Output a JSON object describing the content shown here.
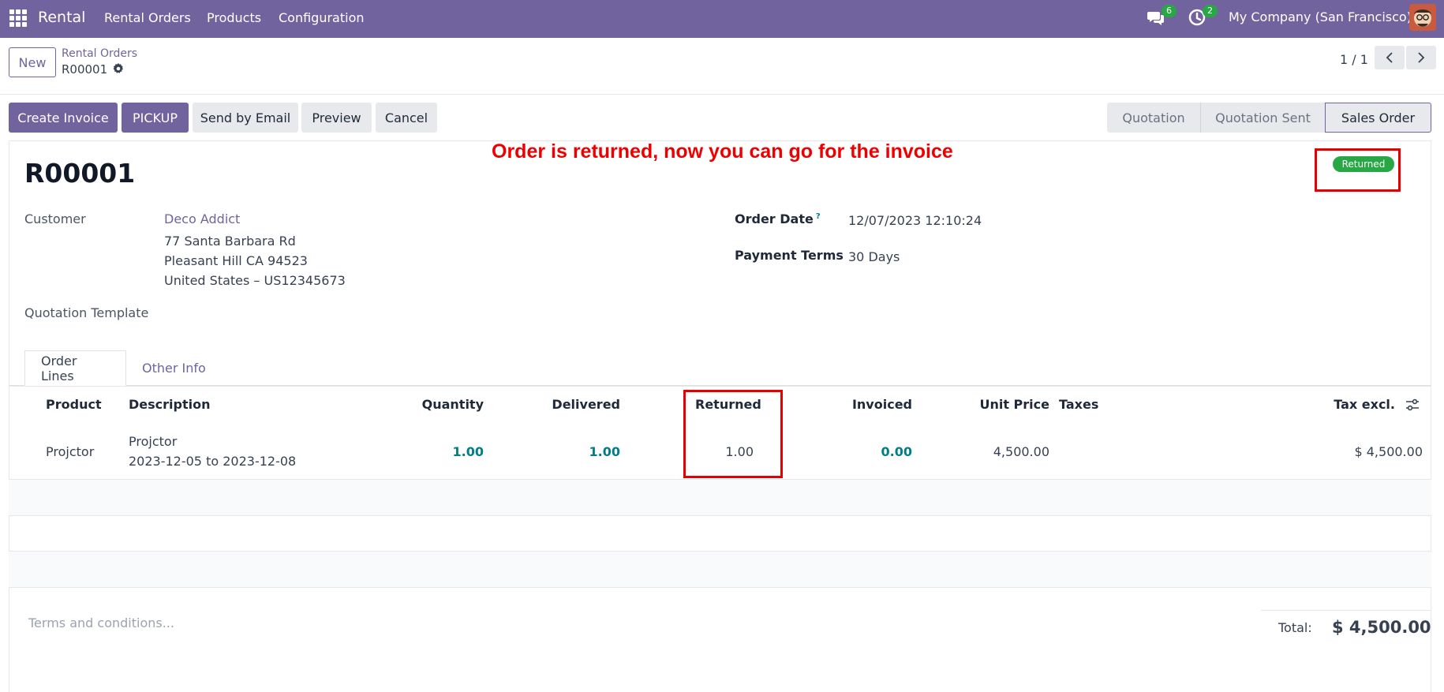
{
  "navbar": {
    "app_name": "Rental",
    "menus": [
      "Rental Orders",
      "Products",
      "Configuration"
    ],
    "messages_count": "6",
    "activities_count": "2",
    "company": "My Company (San Francisco)",
    "bg_color": "#71639e"
  },
  "breadcrumb": {
    "new_label": "New",
    "parent": "Rental Orders",
    "current": "R00001"
  },
  "pager": {
    "value": "1 / 1",
    "prev_icon": "chevron-left-icon",
    "next_icon": "chevron-right-icon"
  },
  "actions": {
    "create_invoice": "Create Invoice",
    "pickup": "PICKUP",
    "send_email": "Send by Email",
    "preview": "Preview",
    "cancel": "Cancel"
  },
  "statusbar": {
    "stages": [
      "Quotation",
      "Quotation Sent",
      "Sales Order"
    ],
    "active": "Sales Order"
  },
  "annotation": "Order is returned, now you can go for the invoice",
  "ribbon": {
    "label": "Returned",
    "color": "#28a745"
  },
  "form": {
    "name": "R00001",
    "customer_label": "Customer",
    "customer_name": "Deco Addict",
    "address_line1": "77 Santa Barbara Rd",
    "address_line2": "Pleasant Hill CA 94523",
    "address_line3": "United States – US12345673",
    "quotation_template_label": "Quotation Template",
    "order_date_label": "Order Date",
    "order_date_help": "?",
    "order_date_value": "12/07/2023 12:10:24",
    "payment_terms_label": "Payment Terms",
    "payment_terms_value": "30 Days"
  },
  "tabs": [
    "Order Lines",
    "Other Info"
  ],
  "table": {
    "headers": {
      "product": "Product",
      "description": "Description",
      "quantity": "Quantity",
      "delivered": "Delivered",
      "returned": "Returned",
      "invoiced": "Invoiced",
      "unit_price": "Unit Price",
      "taxes": "Taxes",
      "tax_excl": "Tax excl."
    },
    "rows": [
      {
        "product": "Projctor",
        "description_line1": "Projctor",
        "description_line2": "2023-12-05 to 2023-12-08",
        "quantity": "1.00",
        "delivered": "1.00",
        "returned": "1.00",
        "invoiced": "0.00",
        "unit_price": "4,500.00",
        "taxes": "",
        "tax_excl": "$ 4,500.00"
      }
    ]
  },
  "footer": {
    "terms_placeholder": "Terms and conditions...",
    "total_label": "Total:",
    "total_value": "$ 4,500.00"
  }
}
